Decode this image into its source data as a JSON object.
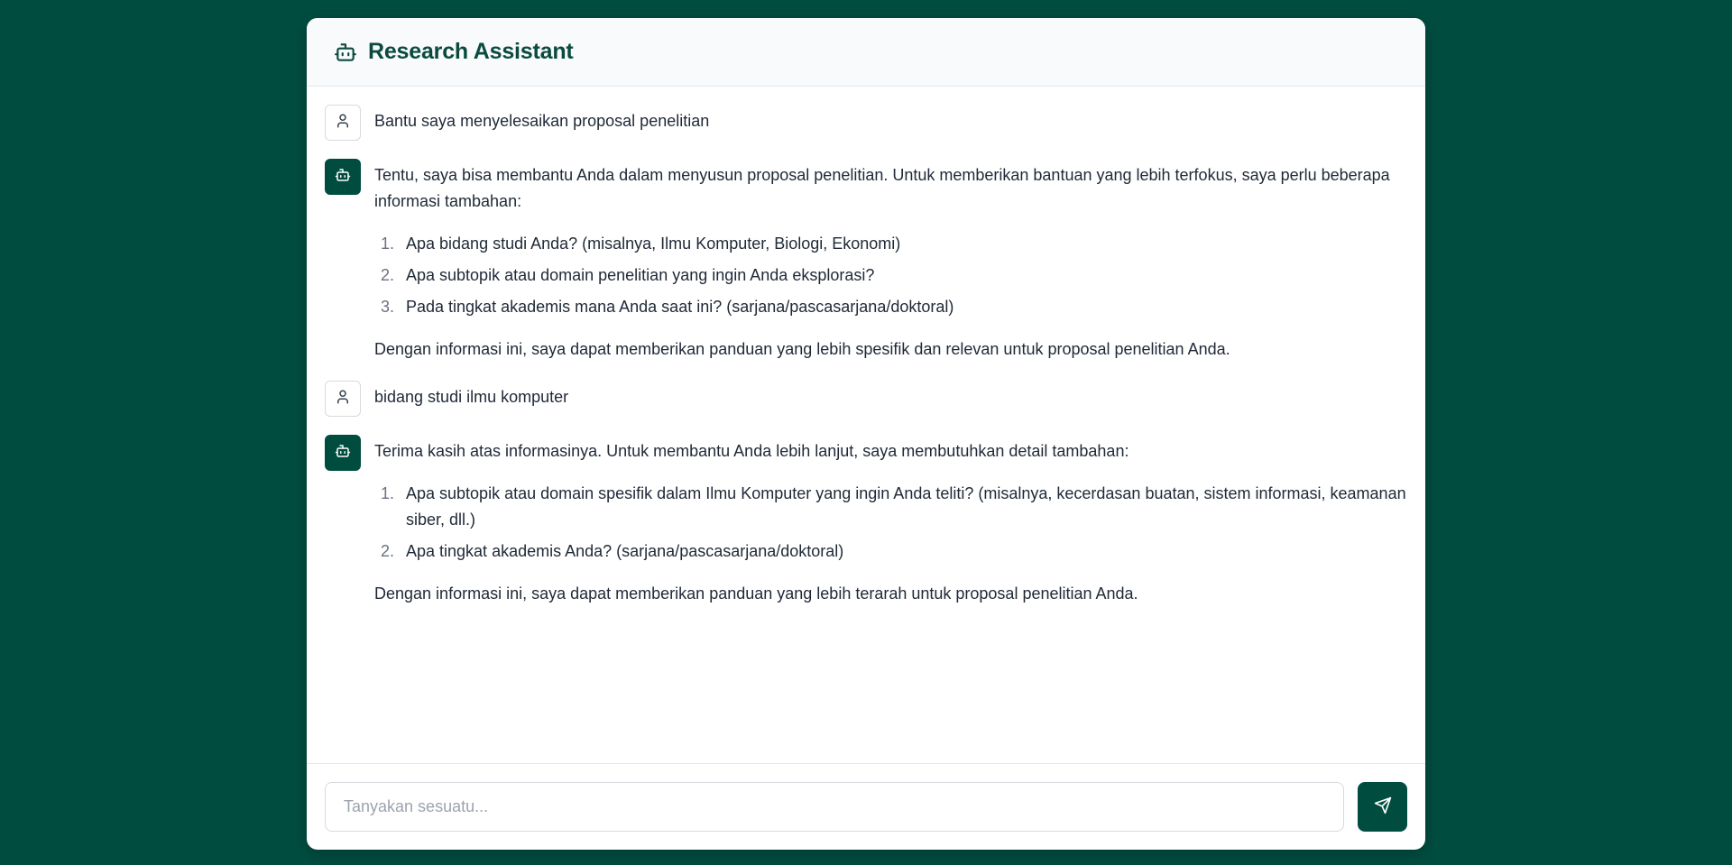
{
  "header": {
    "title": "Research Assistant",
    "icon": "robot-icon"
  },
  "messages": [
    {
      "role": "user",
      "avatar_icon": "user-icon",
      "text": "Bantu saya menyelesaikan proposal penelitian"
    },
    {
      "role": "assistant",
      "avatar_icon": "robot-icon",
      "intro": "Tentu, saya bisa membantu Anda dalam menyusun proposal penelitian. Untuk memberikan bantuan yang lebih terfokus, saya perlu beberapa informasi tambahan:",
      "list": [
        {
          "num": "1.",
          "text": "Apa bidang studi Anda? (misalnya, Ilmu Komputer, Biologi, Ekonomi)"
        },
        {
          "num": "2.",
          "text": "Apa subtopik atau domain penelitian yang ingin Anda eksplorasi?"
        },
        {
          "num": "3.",
          "text": "Pada tingkat akademis mana Anda saat ini? (sarjana/pascasarjana/doktoral)"
        }
      ],
      "outro": "Dengan informasi ini, saya dapat memberikan panduan yang lebih spesifik dan relevan untuk proposal penelitian Anda."
    },
    {
      "role": "user",
      "avatar_icon": "user-icon",
      "text": "bidang studi ilmu komputer"
    },
    {
      "role": "assistant",
      "avatar_icon": "robot-icon",
      "intro": "Terima kasih atas informasinya. Untuk membantu Anda lebih lanjut, saya membutuhkan detail tambahan:",
      "list": [
        {
          "num": "1.",
          "text": "Apa subtopik atau domain spesifik dalam Ilmu Komputer yang ingin Anda teliti? (misalnya, kecerdasan buatan, sistem informasi, keamanan siber, dll.)"
        },
        {
          "num": "2.",
          "text": "Apa tingkat akademis Anda? (sarjana/pascasarjana/doktoral)"
        }
      ],
      "outro": "Dengan informasi ini, saya dapat memberikan panduan yang lebih terarah untuk proposal penelitian Anda."
    }
  ],
  "composer": {
    "placeholder": "Tanyakan sesuatu...",
    "value": "",
    "send_icon": "send-icon"
  },
  "colors": {
    "background": "#004d40",
    "accent": "#004d40",
    "title": "#0b4a3f"
  }
}
